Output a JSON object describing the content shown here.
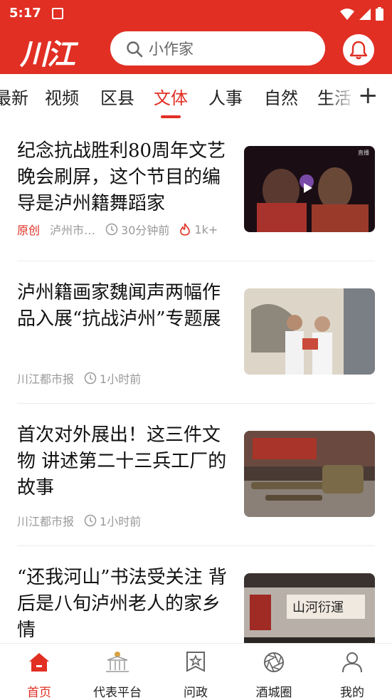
{
  "status": {
    "time": "5:17"
  },
  "header": {
    "logo": "川江",
    "search_placeholder": "小作家"
  },
  "tabs": [
    "最新",
    "视频",
    "区县",
    "文体",
    "人事",
    "自然",
    "生活"
  ],
  "active_tab": "文体",
  "more_tab": "+",
  "articles": [
    {
      "title": "纪念抗战胜利80周年文艺晚会刷屏，这个节目的编导是泸州籍舞蹈家",
      "tag": "原创",
      "source": "泸州市…",
      "time": "30分钟前",
      "heat": "1k+"
    },
    {
      "title": "泸州籍画家魏闻声两幅作品入展“抗战泸州”专题展",
      "source": "川江都市报",
      "time": "1小时前"
    },
    {
      "title": "首次对外展出！这三件文物 讲述第二十三兵工厂的故事",
      "source": "川江都市报",
      "time": "1小时前"
    },
    {
      "title": "“还我河山”书法受关注 背后是八旬泸州老人的家乡情"
    }
  ],
  "bottom_nav": [
    {
      "label": "首页",
      "icon": "home-icon"
    },
    {
      "label": "代表平台",
      "icon": "hall-icon"
    },
    {
      "label": "问政",
      "icon": "star-badge-icon"
    },
    {
      "label": "酒城圈",
      "icon": "aperture-icon"
    },
    {
      "label": "我的",
      "icon": "user-icon"
    }
  ],
  "colors": {
    "brand": "#e12f24"
  }
}
